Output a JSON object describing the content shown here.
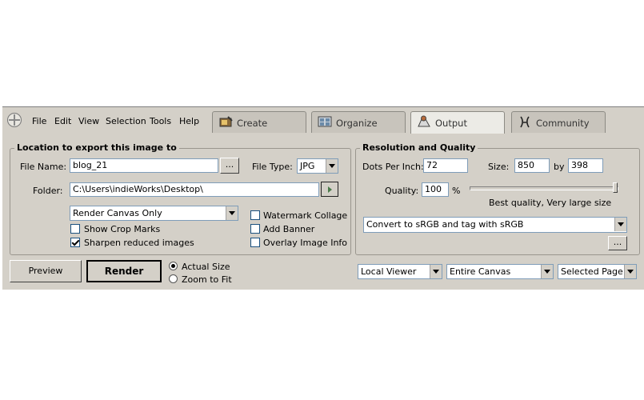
{
  "menu": [
    "File",
    "Edit",
    "View",
    "Selection",
    "Tools",
    "Help"
  ],
  "tabs": [
    {
      "label": "Create",
      "icon": "create-icon"
    },
    {
      "label": "Organize",
      "icon": "organize-icon"
    },
    {
      "label": "Output",
      "icon": "output-icon",
      "active": true
    },
    {
      "label": "Community",
      "icon": "community-icon"
    }
  ],
  "location": {
    "title": "Location to export this image to",
    "file_name_label": "File Name:",
    "file_name_value": "blog_21",
    "browse_label": "...",
    "file_type_label": "File Type:",
    "file_type_value": "JPG",
    "folder_label": "Folder:",
    "folder_value": "C:\\Users\\indieWorks\\Desktop\\",
    "render_mode": "Render Canvas Only",
    "show_crop_marks": {
      "label": "Show Crop Marks",
      "checked": false
    },
    "sharpen_reduced": {
      "label": "Sharpen reduced images",
      "checked": true
    },
    "watermark_collage": {
      "label": "Watermark Collage",
      "checked": false
    },
    "add_banner": {
      "label": "Add Banner",
      "checked": false
    },
    "overlay_info": {
      "label": "Overlay Image Info",
      "checked": false
    }
  },
  "resolution": {
    "title": "Resolution and Quality",
    "dpi_label": "Dots Per Inch:",
    "dpi_value": "72",
    "size_label": "Size:",
    "width_value": "850",
    "by_label": "by",
    "height_value": "398",
    "quality_label": "Quality:",
    "quality_value": "100",
    "quality_unit": "%",
    "quality_level": 1.0,
    "quality_desc": "Best quality, Very large size",
    "color_profile": "Convert to sRGB and tag with sRGB",
    "more_label": "..."
  },
  "actions": {
    "preview_label": "Preview",
    "render_label": "Render",
    "actual_size_label": "Actual Size",
    "zoom_to_fit_label": "Zoom to Fit",
    "size_mode": "actual"
  },
  "viewer": {
    "viewer_value": "Local Viewer",
    "canvas_value": "Entire Canvas",
    "page_value": "Selected Page"
  }
}
